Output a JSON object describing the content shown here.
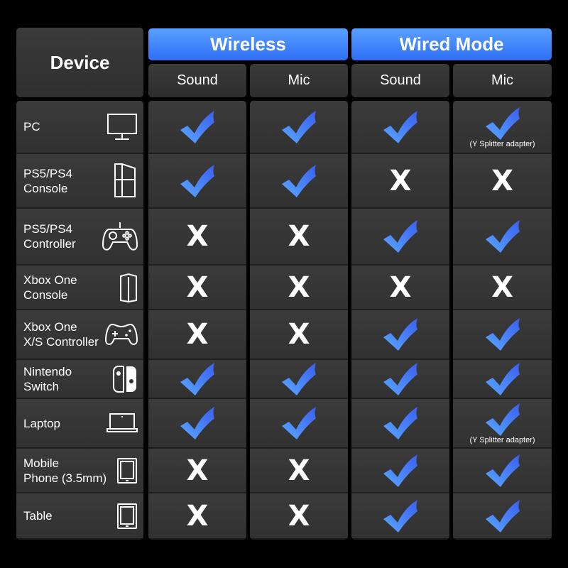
{
  "header": {
    "device": "Device",
    "groups": [
      {
        "label": "Wireless",
        "columns": [
          "Sound",
          "Mic"
        ]
      },
      {
        "label": "Wired Mode",
        "columns": [
          "Sound",
          "Mic"
        ]
      }
    ]
  },
  "colors": {
    "check": "#3d7bff",
    "header_blue": "#3f82fb",
    "cross": "#ffffff"
  },
  "rows": [
    {
      "device": "PC",
      "icon": "monitor-icon",
      "values": [
        "check",
        "check",
        "check",
        "check"
      ],
      "notes": [
        "",
        "",
        "",
        "(Y Splitter adapter)"
      ]
    },
    {
      "device": "PS5/PS4\nConsole",
      "icon": "console-icon",
      "values": [
        "check",
        "check",
        "cross",
        "cross"
      ],
      "notes": [
        "",
        "",
        "",
        ""
      ]
    },
    {
      "device": "PS5/PS4\nController",
      "icon": "ps-controller-icon",
      "values": [
        "cross",
        "cross",
        "check",
        "check"
      ],
      "notes": [
        "",
        "",
        "",
        ""
      ]
    },
    {
      "device": "Xbox One\nConsole",
      "icon": "xbox-console-icon",
      "values": [
        "cross",
        "cross",
        "cross",
        "cross"
      ],
      "notes": [
        "",
        "",
        "",
        ""
      ]
    },
    {
      "device": "Xbox One\nX/S Controller",
      "icon": "xbox-controller-icon",
      "values": [
        "cross",
        "cross",
        "check",
        "check"
      ],
      "notes": [
        "",
        "",
        "",
        ""
      ]
    },
    {
      "device": "Nintendo\nSwitch",
      "icon": "switch-icon",
      "values": [
        "check",
        "check",
        "check",
        "check"
      ],
      "notes": [
        "",
        "",
        "",
        ""
      ]
    },
    {
      "device": "Laptop",
      "icon": "laptop-icon",
      "values": [
        "check",
        "check",
        "check",
        "check"
      ],
      "notes": [
        "",
        "",
        "",
        "(Y Splitter adapter)"
      ]
    },
    {
      "device": "Mobile\nPhone (3.5mm)",
      "icon": "tablet-icon",
      "values": [
        "cross",
        "cross",
        "check",
        "check"
      ],
      "notes": [
        "",
        "",
        "",
        ""
      ]
    },
    {
      "device": "Table",
      "icon": "tablet-icon",
      "values": [
        "cross",
        "cross",
        "check",
        "check"
      ],
      "notes": [
        "",
        "",
        "",
        ""
      ]
    }
  ],
  "cross_glyph": "X"
}
